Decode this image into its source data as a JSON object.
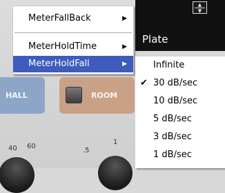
{
  "main_menu": {
    "items": [
      {
        "label": "MeterFallBack",
        "arrow": "▶",
        "selected": false
      },
      {
        "label": "MeterHoldTime",
        "arrow": "▶",
        "selected": false
      },
      {
        "label": "MeterHoldFall",
        "arrow": "▶",
        "selected": true
      }
    ]
  },
  "sub_menu": {
    "items": [
      {
        "label": "Infinite",
        "checked": false
      },
      {
        "label": "30 dB/sec",
        "checked": true
      },
      {
        "label": "10 dB/sec",
        "checked": false
      },
      {
        "label": "5 dB/sec",
        "checked": false
      },
      {
        "label": "3 dB/sec",
        "checked": false
      },
      {
        "label": "1 dB/sec",
        "checked": false
      }
    ],
    "check_glyph": "✔"
  },
  "plugin": {
    "preset_value": "Plate",
    "spinner_up": "▲",
    "spinner_down": "▼",
    "hall_label": "HALL",
    "room_label": "ROOM",
    "knob1_labels": [
      "40",
      "60"
    ],
    "knob2_labels": [
      ".5",
      "1"
    ],
    "colors": {
      "menu_highlight": "#3f5bbb",
      "hall_button": "#8da6c8",
      "room_button": "#c9a187"
    }
  }
}
